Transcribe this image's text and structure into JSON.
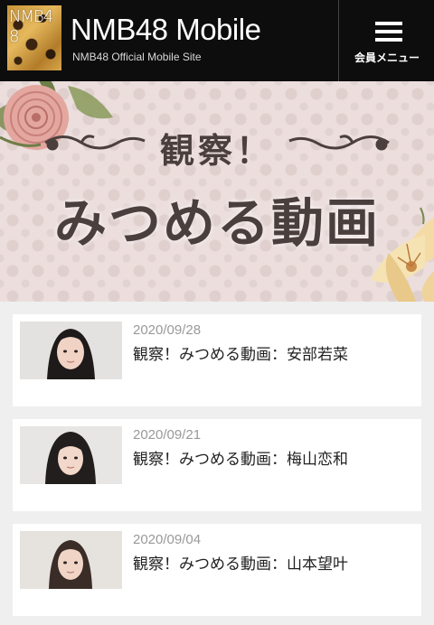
{
  "header": {
    "logo_text": "NMB48",
    "title": "NMB48 Mobile",
    "subtitle": "NMB48 Official Mobile Site",
    "menu_label": "会員メニュー"
  },
  "banner": {
    "small_heading": "観察！",
    "big_heading": "みつめる動画"
  },
  "videos": [
    {
      "date": "2020/09/28",
      "title": "観察！みつめる動画：安部若菜"
    },
    {
      "date": "2020/09/21",
      "title": "観察！みつめる動画：梅山恋和"
    },
    {
      "date": "2020/09/04",
      "title": "観察！みつめる動画：山本望叶"
    }
  ],
  "colors": {
    "header_bg": "#0d0d0d",
    "banner_bg": "#ebdedd",
    "banner_text": "#4a3f3d",
    "date_text": "#999999",
    "page_bg": "#efefef"
  },
  "icons": [
    "hamburger-menu-icon",
    "rose-decoration",
    "lily-decoration"
  ]
}
